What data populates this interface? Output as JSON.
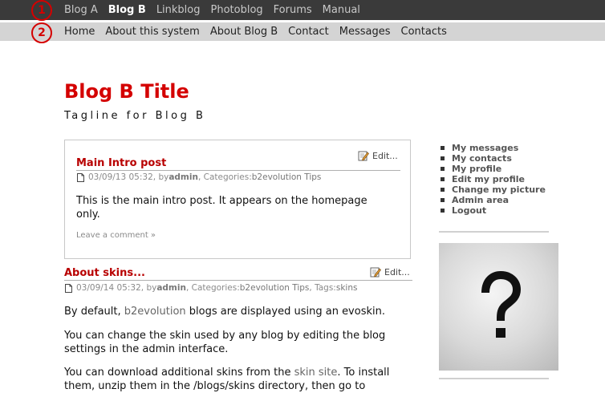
{
  "annotations": {
    "marker1": "1",
    "marker2": "2"
  },
  "top_nav": {
    "items": [
      "Blog A",
      "Blog B",
      "Linkblog",
      "Photoblog",
      "Forums",
      "Manual"
    ],
    "active": "Blog B"
  },
  "sub_nav": {
    "items": [
      "Home",
      "About this system",
      "About Blog B",
      "Contact",
      "Messages",
      "Contacts"
    ]
  },
  "blog": {
    "title": "Blog B Title",
    "tagline": "Tagline for Blog B"
  },
  "posts": [
    {
      "title": "Main Intro post",
      "edit_label": "Edit...",
      "date": "03/09/13 05:32",
      "by_label": ", by ",
      "author": "admin",
      "categories_label": ", Categories: ",
      "categories": "b2evolution Tips",
      "body": "This is the main intro post. It appears on the homepage only.",
      "comment_link": "Leave a comment »"
    },
    {
      "title": "About skins...",
      "edit_label": "Edit...",
      "date": "03/09/14 05:32",
      "by_label": ", by ",
      "author": "admin",
      "categories_label": ", Categories: ",
      "categories": "b2evolution Tips",
      "tags_label": ", Tags: ",
      "tags": "skins",
      "p1_before": "By default, ",
      "p1_link": "b2evolution",
      "p1_after": " blogs are displayed using an evoskin.",
      "p2": "You can change the skin used by any blog by editing the blog settings in the admin interface.",
      "p3_before": "You can download additional skins from the ",
      "p3_link": "skin site",
      "p3_after": ". To install them, unzip them in the /blogs/skins directory, then go to"
    }
  ],
  "sidebar": {
    "items": [
      "My messages",
      "My contacts",
      "My profile",
      "Edit my profile",
      "Change my picture",
      "Admin area",
      "Logout"
    ]
  },
  "colors": {
    "accent": "#d40000",
    "top_bar": "#3a3a3a",
    "sub_bar": "#d4d4d4"
  }
}
